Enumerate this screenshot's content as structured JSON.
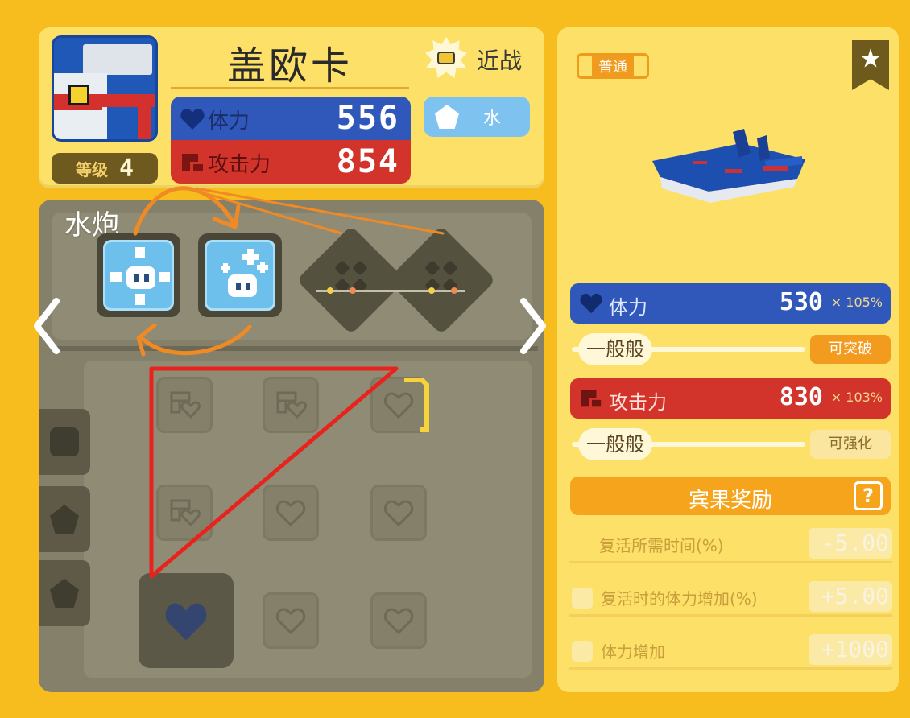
{
  "pokemon": {
    "name": "盖欧卡",
    "level_label": "等级",
    "level": "4",
    "attack_style": "近战",
    "type": "水",
    "hp_label": "体力",
    "hp": "556",
    "atk_label": "攻击力",
    "atk": "854"
  },
  "moves": {
    "section_label": "水炮",
    "equipped": [
      "skill-cross-icon",
      "skill-plus-icon"
    ],
    "empty_slots": 2
  },
  "details": {
    "rarity": "普通",
    "hp_label": "体力",
    "hp": "530",
    "hp_mult": "× 105%",
    "hp_rating": "一般般",
    "hp_action": "可突破",
    "atk_label": "攻击力",
    "atk": "830",
    "atk_mult": "× 103%",
    "atk_rating": "一般般",
    "atk_action": "可强化",
    "bingo_title": "宾果奖励",
    "help": "?",
    "bonuses": [
      {
        "label": "复活所需时间(%)",
        "value": "-5.00"
      },
      {
        "label": "复活时的体力增加(%)",
        "value": "+5.00"
      },
      {
        "label": "体力增加",
        "value": "+1000"
      }
    ]
  },
  "colors": {
    "background": "#f7bd1f",
    "hp_blue": "#2f58ba",
    "atk_red": "#d2332b",
    "annotation_red": "#e8231e",
    "annotation_orange": "#f08a24"
  }
}
